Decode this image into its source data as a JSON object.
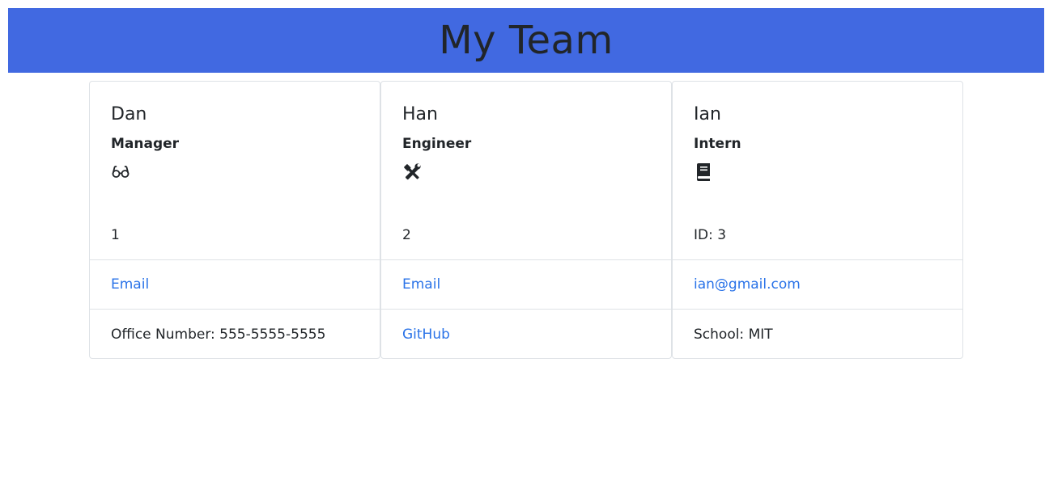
{
  "header": {
    "title": "My Team",
    "background_color": "#4169e1"
  },
  "team": [
    {
      "name": "Dan",
      "role": "Manager",
      "icon": "glasses-icon",
      "id_text": "1",
      "email_text": "Email",
      "extra_text": "Office Number: 555-5555-5555"
    },
    {
      "name": "Han",
      "role": "Engineer",
      "icon": "tools-icon",
      "id_text": "2",
      "email_text": "Email",
      "extra_text": "GitHub"
    },
    {
      "name": "Ian",
      "role": "Intern",
      "icon": "book-icon",
      "id_text": "ID: 3",
      "email_text": "ian@gmail.com",
      "extra_text": "School: MIT"
    }
  ],
  "colors": {
    "link": "#2a73e8",
    "border": "#dee2e6"
  }
}
